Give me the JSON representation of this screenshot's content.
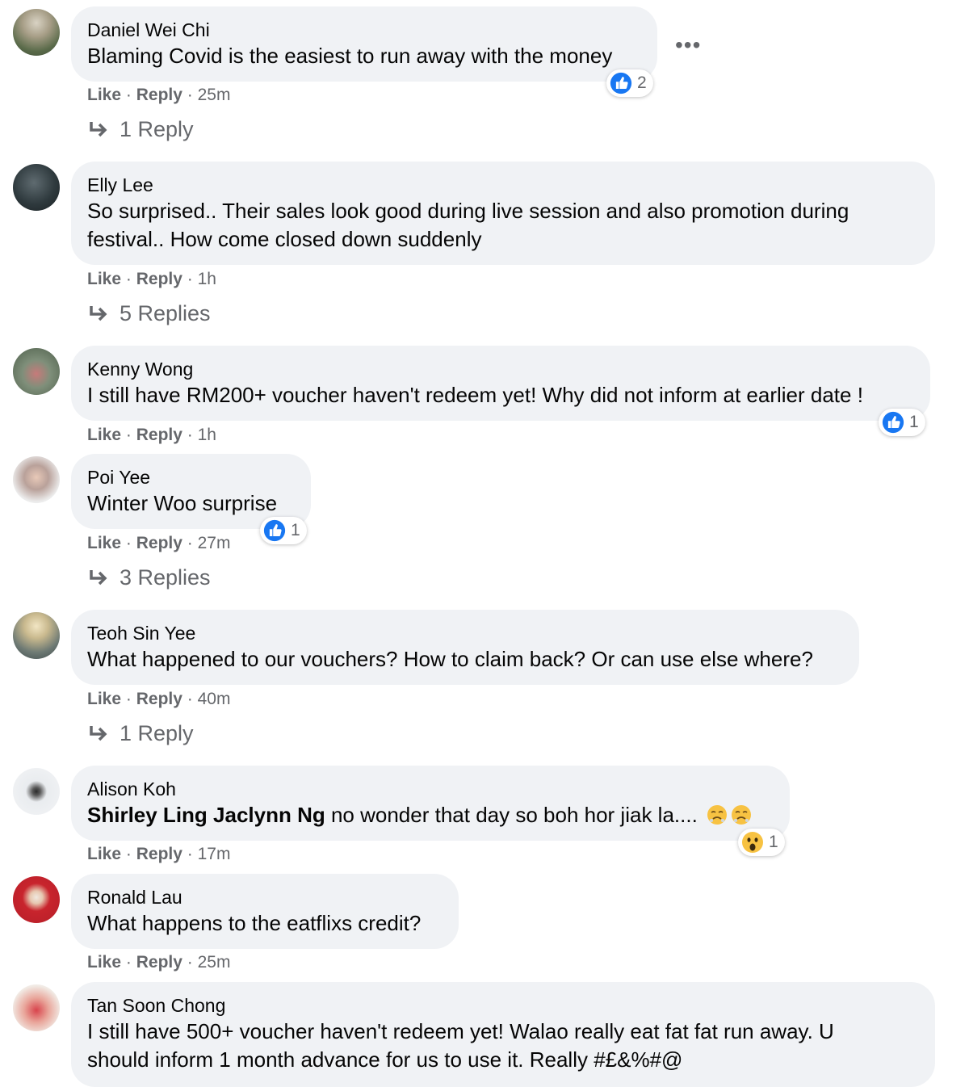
{
  "comments": [
    {
      "name": "Daniel Wei Chi",
      "text": "Blaming Covid is the easiest to run away with the money",
      "like": "Like",
      "reply": "Reply",
      "time": "25m",
      "reaction_count": "2",
      "replies": "1 Reply"
    },
    {
      "name": "Elly Lee",
      "text_line1": "So surprised.. Their sales look good during live session and also promotion during",
      "text_line2": "festival.. How come closed down suddenly",
      "like": "Like",
      "reply": "Reply",
      "time": "1h",
      "replies": "5 Replies"
    },
    {
      "name": "Kenny Wong",
      "text": "I still have RM200+ voucher haven't redeem yet! Why did not inform at earlier date !",
      "like": "Like",
      "reply": "Reply",
      "time": "1h",
      "reaction_count": "1"
    },
    {
      "name": "Poi Yee",
      "text": "Winter Woo surprise",
      "like": "Like",
      "reply": "Reply",
      "time": "27m",
      "reaction_count": "1",
      "replies": "3 Replies"
    },
    {
      "name": "Teoh Sin Yee",
      "text": "What happened to our vouchers? How to claim back? Or can use else where?",
      "like": "Like",
      "reply": "Reply",
      "time": "40m",
      "replies": "1 Reply"
    },
    {
      "name": "Alison Koh",
      "mention": "Shirley Ling Jaclynn Ng",
      "text": "no wonder that day so boh hor jiak la....",
      "like": "Like",
      "reply": "Reply",
      "time": "17m",
      "reaction_count": "1"
    },
    {
      "name": "Ronald Lau",
      "text": "What happens to the eatflixs credit?",
      "like": "Like",
      "reply": "Reply",
      "time": "25m"
    },
    {
      "name": "Tan Soon Chong",
      "text_line1": "I still have 500+ voucher haven't redeem yet! Walao really eat fat fat run away. U",
      "text_line2": "should inform 1 month advance for us to use it. Really #£&%#@"
    }
  ],
  "separator": "·",
  "more_label": "•••",
  "icons": {
    "reaction": "like-thumb-icon",
    "reaction_wow": "wow-emoji-icon",
    "reply_arrow": "reply-arrow-icon",
    "more": "more-options-icon"
  },
  "colors": {
    "bubble": "#f0f2f5",
    "secondary_text": "#65676b",
    "like_blue": "#1877f2"
  }
}
